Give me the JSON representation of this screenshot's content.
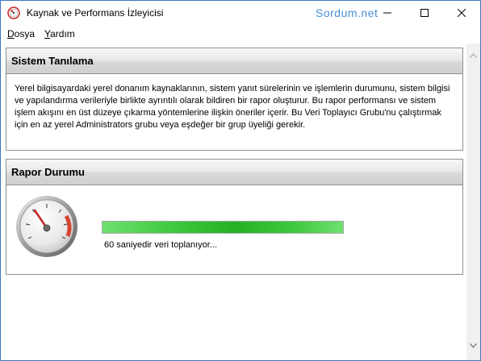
{
  "window": {
    "title": "Kaynak ve Performans İzleyicisi",
    "watermark": "Sordum.net",
    "app_icon": "perfmon-icon",
    "accent": "#3c74c4"
  },
  "menu": [
    {
      "label": "Dosya",
      "accel": "D",
      "rest": "osya"
    },
    {
      "label": "Yardım",
      "accel": "Y",
      "rest": "ardım"
    }
  ],
  "panels": {
    "diagnostics": {
      "title": "Sistem Tanılama",
      "description": "Yerel bilgisayardaki yerel donanım kaynaklarının, sistem yanıt sürelerinin ve işlemlerin durumunu, sistem bilgisi ve yapılandırma verileriyle birlikte ayrıntılı olarak bildiren bir rapor oluşturur. Bu rapor performansı ve sistem işlem akışını en üst düzeye çıkarma yöntemlerine ilişkin öneriler içerir. Bu Veri Toplayıcı Grubu'nu çalıştırmak için en az yerel Administrators grubu veya eşdeğer bir grup üyeliği gerekir."
    },
    "report_status": {
      "title": "Rapor Durumu",
      "progress_fraction": 1.0,
      "progress_color": "#23b123",
      "status_text": "60 saniyedir veri toplanıyor...",
      "gauge_icon": "speedometer-gauge-icon"
    }
  }
}
